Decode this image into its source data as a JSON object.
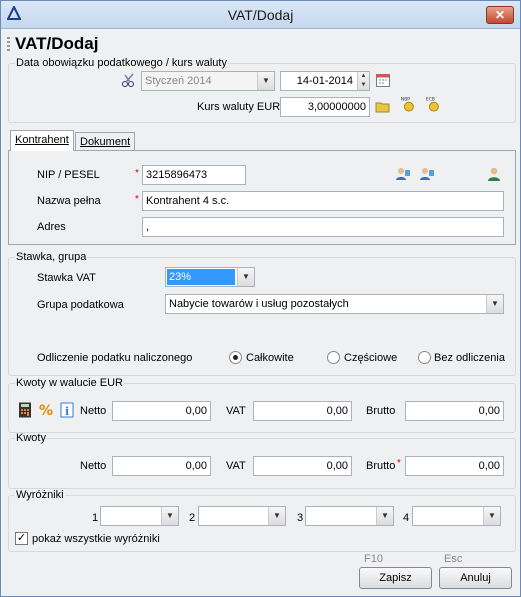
{
  "window": {
    "title": "VAT/Dodaj"
  },
  "header": {
    "title": "VAT/Dodaj"
  },
  "section_tax_date": {
    "legend": "Data obowiązku podatkowego / kurs waluty",
    "month_value": "Styczeń 2014",
    "date_value": "14-01-2014",
    "rate_label": "Kurs waluty EUR",
    "rate_value": "3,00000000"
  },
  "tabs": [
    {
      "label": "Kontrahent"
    },
    {
      "label": "Dokument"
    }
  ],
  "contractor": {
    "nip_label": "NIP / PESEL",
    "nip_value": "3215896473",
    "name_label": "Nazwa pełna",
    "name_value": "Kontrahent 4 s.c.",
    "address_label": "Adres",
    "address_value": ","
  },
  "rate_group": {
    "legend": "Stawka, grupa",
    "vat_label": "Stawka VAT",
    "vat_value": "23%",
    "group_label": "Grupa podatkowa",
    "group_value": "Nabycie towarów i usług pozostałych",
    "deduction_label": "Odliczenie podatku naliczonego",
    "options": [
      "Całkowite",
      "Częściowe",
      "Bez odliczenia"
    ],
    "selected": "Całkowite"
  },
  "amounts_eur": {
    "legend": "Kwoty w walucie EUR",
    "netto_label": "Netto",
    "netto": "0,00",
    "vat_label": "VAT",
    "vat": "0,00",
    "brutto_label": "Brutto",
    "brutto": "0,00"
  },
  "amounts": {
    "legend": "Kwoty",
    "netto_label": "Netto",
    "netto": "0,00",
    "vat_label": "VAT",
    "vat": "0,00",
    "brutto_label": "Brutto",
    "brutto": "0,00"
  },
  "markers": {
    "legend": "Wyróżniki",
    "labels": [
      "1",
      "2",
      "3",
      "4"
    ],
    "show_all_label": "pokaż wszystkie wyróżniki",
    "show_all_checked": true
  },
  "footer": {
    "save_hint": "F10",
    "save_label": "Zapisz",
    "cancel_hint": "Esc",
    "cancel_label": "Anuluj"
  },
  "colors": {
    "accent": "#3399ff",
    "required": "#dd0000"
  }
}
